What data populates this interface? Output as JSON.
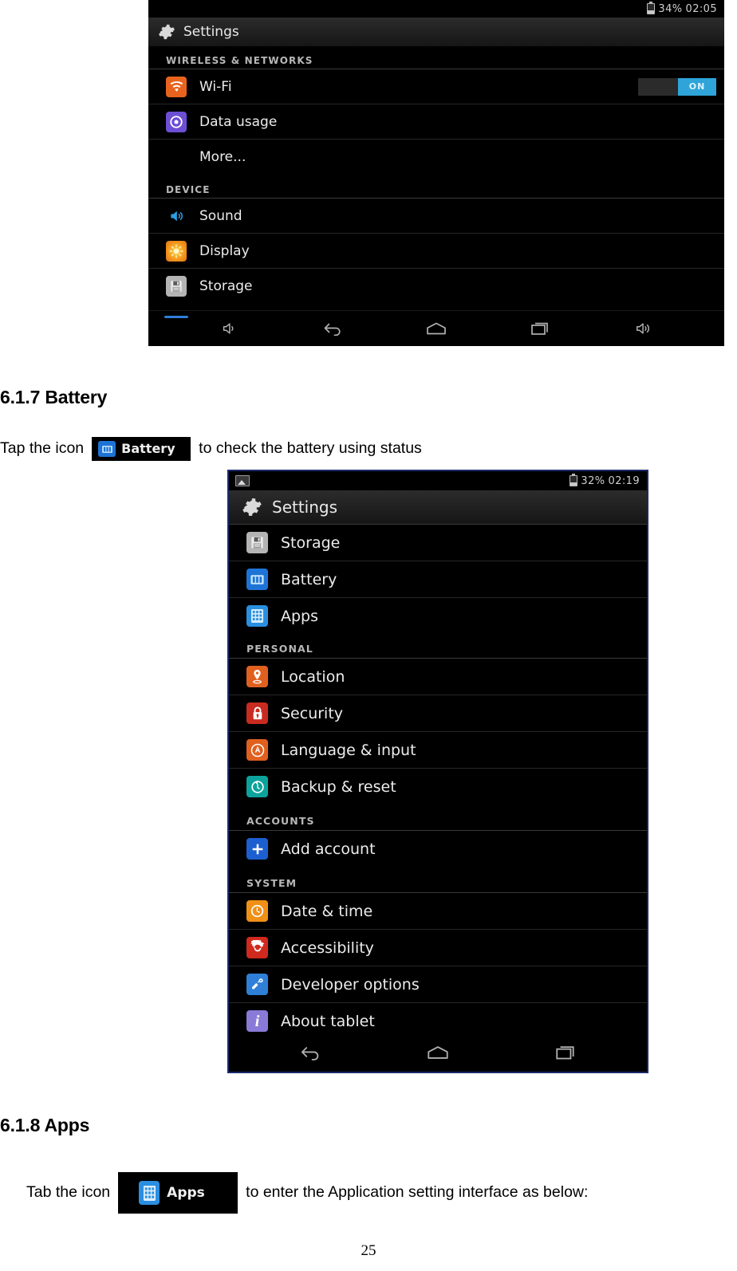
{
  "document": {
    "page_number": "25",
    "sections": [
      {
        "heading": "6.1.7 Battery",
        "body_before": "Tap the icon",
        "chip_label": "Battery",
        "body_after": "to check the battery using status"
      },
      {
        "heading": "6.1.8 Apps",
        "body_before": "Tab the icon",
        "chip_label": "Apps",
        "body_after": "to enter the Application setting interface as below:"
      }
    ]
  },
  "screenshot_top": {
    "statusbar": {
      "battery_percent": "34%",
      "time": "02:05"
    },
    "actionbar": {
      "title": "Settings"
    },
    "sections": [
      {
        "header": "WIRELESS & NETWORKS",
        "rows": [
          {
            "label": "Wi-Fi",
            "icon": "wifi-icon",
            "color": "#e8641e",
            "glyph": "◞",
            "toggle": "ON"
          },
          {
            "label": "Data usage",
            "icon": "data-usage-icon",
            "color": "#6d4fd6",
            "glyph": "◉"
          },
          {
            "label": "More...",
            "icon": "none",
            "color": "",
            "glyph": ""
          }
        ]
      },
      {
        "header": "DEVICE",
        "rows": [
          {
            "label": "Sound",
            "icon": "speaker-icon",
            "color": "#2196d8",
            "glyph": "◂"
          },
          {
            "label": "Display",
            "icon": "brightness-icon",
            "color": "#f0951c",
            "glyph": "☀"
          },
          {
            "label": "Storage",
            "icon": "floppy-disk-icon",
            "color": "#9a9a9a",
            "glyph": "▤"
          }
        ]
      }
    ],
    "navbar": [
      "volume-down-icon",
      "back-icon",
      "home-icon",
      "recents-icon",
      "volume-up-icon"
    ]
  },
  "screenshot_bottom": {
    "statusbar": {
      "left_icon": "screenshot-icon",
      "battery_percent": "32%",
      "time": "02:19"
    },
    "actionbar": {
      "title": "Settings"
    },
    "sections": [
      {
        "header": "",
        "rows": [
          {
            "label": "Storage",
            "icon": "floppy-disk-icon",
            "color": "#9a9a9a",
            "glyph": "▤"
          },
          {
            "label": "Battery",
            "icon": "battery-icon",
            "color": "#1e74d6",
            "glyph": "▓"
          },
          {
            "label": "Apps",
            "icon": "apps-grid-icon",
            "color": "#2a8fe0",
            "glyph": "☷"
          }
        ]
      },
      {
        "header": "PERSONAL",
        "rows": [
          {
            "label": "Location",
            "icon": "location-pin-icon",
            "color": "#e0601f",
            "glyph": "⚑"
          },
          {
            "label": "Security",
            "icon": "lock-icon",
            "color": "#c92b20",
            "glyph": "ὑ2"
          },
          {
            "label": "Language & input",
            "icon": "language-icon",
            "color": "#e0601f",
            "glyph": "Ⓐ"
          },
          {
            "label": "Backup & reset",
            "icon": "backup-reset-icon",
            "color": "#0da39c",
            "glyph": "↺"
          }
        ]
      },
      {
        "header": "ACCOUNTS",
        "rows": [
          {
            "label": "Add account",
            "icon": "plus-icon",
            "color": "#1c5fd0",
            "glyph": "+"
          }
        ]
      },
      {
        "header": "SYSTEM",
        "rows": [
          {
            "label": "Date & time",
            "icon": "clock-icon",
            "color": "#f09017",
            "glyph": "○"
          },
          {
            "label": "Accessibility",
            "icon": "accessibility-gear-icon",
            "color": "#d02a1e",
            "glyph": "⚙"
          },
          {
            "label": "Developer options",
            "icon": "developer-options-icon",
            "color": "#2f7fd8",
            "glyph": "⚒"
          },
          {
            "label": "About tablet",
            "icon": "info-icon",
            "color": "#8a7ad8",
            "glyph": "i"
          }
        ]
      }
    ],
    "navbar": [
      "back-icon",
      "home-icon",
      "recents-icon"
    ]
  },
  "colors": {
    "accent_blue": "#2ea4d8",
    "frame_blue": "#1b2a6b",
    "screen_black": "#000000"
  }
}
